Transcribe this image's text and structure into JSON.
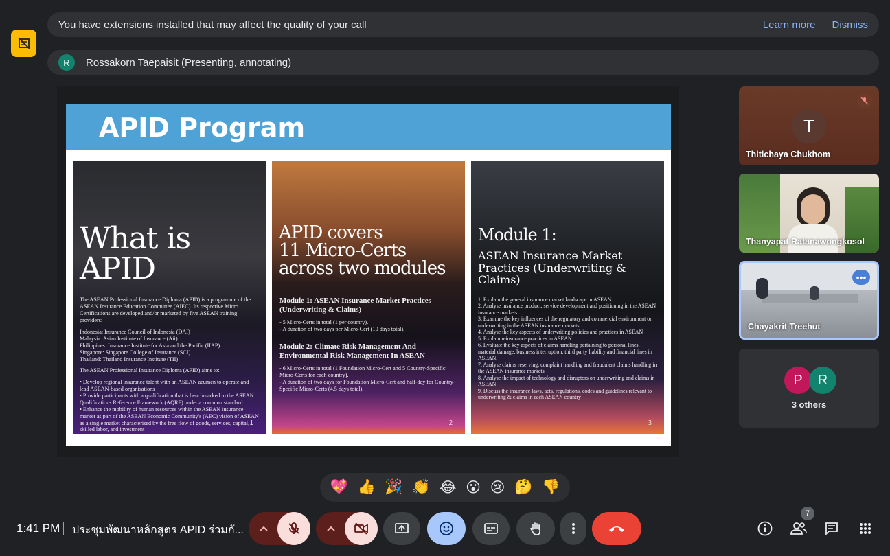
{
  "notice": {
    "message": "You have extensions installed that may affect the quality of your call",
    "learn_more": "Learn more",
    "dismiss": "Dismiss"
  },
  "presenter": {
    "avatar_letter": "R",
    "label": "Rossakorn Taepaisit (Presenting, annotating)"
  },
  "slide": {
    "title": "APID Program",
    "card1": {
      "big_line1": "What is",
      "big_line2": "APID",
      "intro": "The ASEAN Professional Insurance Diploma (APID) is a programme of the ASEAN Insurance Education Committee (AIEC). Its respective Micro Certifications are developed and/or marketed by five ASEAN training providers:",
      "providers": [
        "Indonesia: Insurance Council of Indonesia (DAI)",
        "Malaysia: Asian Institute of Insurance (Aii)",
        "Philippines: Insurance Institute for Asia and the Pacific (IIAP)",
        "Singapore: Singapore College of Insurance (SCI)",
        "Thailand: Thailand Insurance Institute (TII)"
      ],
      "aims_head": "The ASEAN Professional Insurance Diploma (APID) aims to:",
      "aims": "• Develop regional insurance talent with an ASEAN acumen to operate and lead ASEAN-based organisations\n• Provide participants with a qualification that is benchmarked to the ASEAN Qualifications Reference Framework (AQRF) under a common standard\n• Enhance the mobility of human resources within the ASEAN insurance market as part of the ASEAN Economic Community's (AEC) vision of ASEAN as a single market characterised by the free flow of goods, services, capital, skilled labor, and investment",
      "page": "1"
    },
    "card2": {
      "big_line1": "APID covers",
      "big_line2": "11 Micro-Certs",
      "big_line3": "across two modules",
      "m1_head": "Module 1: ASEAN Insurance Market Practices (Underwriting & Claims)",
      "m1_body": "- 5 Micro-Certs in total (1 per country).\n- A duration of two days per Micro-Cert (10 days total).",
      "m2_head": "Module 2: Climate Risk Management And Environmental Risk Management In ASEAN",
      "m2_body": "- 6 Micro-Certs in total (1 Foundation Micro-Cert and 5 Country-Specific Micro-Certs for each country).\n- A duration of two days for Foundation Micro-Cert and half-day for Country-Specific Micro-Certs (4.5 days total).",
      "page": "2"
    },
    "card3": {
      "big_line1": "Module 1:",
      "sub": "ASEAN Insurance Market Practices (Underwriting & Claims)",
      "items": "1. Explain the general insurance market landscape in ASEAN\n2. Analyse insurance product, service development and positioning in the ASEAN insurance markets\n3. Examine the key influences of the regulatory and commercial environment on underwriting in the ASEAN insurance markets\n4. Analyse the key aspects of underwriting policies and practices in ASEAN\n5. Explain reinsurance practices in ASEAN\n6. Evaluate the key aspects of claims handling pertaining to personal lines, material damage, business interruption, third party liability and financial lines in ASEAN.\n7. Analyse claims reserving, complaint handling and fraudulent claims handling in the ASEAN insurance markets\n8. Analyse the impact of technology and disruptors on underwriting and claims in ASEAN\n9. Discuss the insurance laws, acts, regulations, codes and guidelines relevant to underwriting & claims in each ASEAN country",
      "page": "3"
    }
  },
  "participants": [
    {
      "name": "Thitichaya Chukhom",
      "letter": "T"
    },
    {
      "name": "Thanyapat Ratanawongkosol"
    },
    {
      "name": "Chayakrit Treehut"
    }
  ],
  "others": {
    "label": "3 others",
    "letters": [
      "P",
      "R"
    ]
  },
  "reactions": [
    "💖",
    "👍",
    "🎉",
    "👏",
    "😂",
    "😮",
    "😢",
    "🤔",
    "👎"
  ],
  "bottom": {
    "time": "1:41 PM",
    "meeting_title": "ประชุมพัฒนาหลักสูตร APID ร่วมกั...",
    "people_count": "7"
  },
  "colors": {
    "end_call": "#ea4335",
    "muted_bg": "#f9dedc",
    "reaction_active": "#a8c7fa",
    "link": "#8ab4f8"
  }
}
